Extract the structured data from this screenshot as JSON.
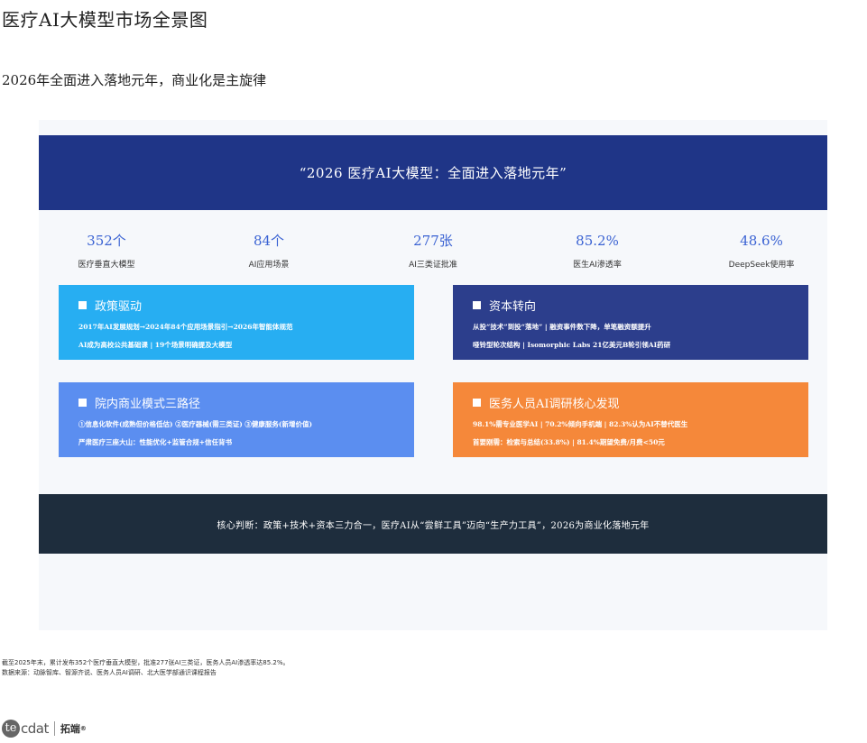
{
  "header": {
    "title": "医疗AI大模型市场全景图",
    "subtitle": "2026年全面进入落地元年，商业化是主旋律"
  },
  "banner": {
    "text": "“2026 医疗AI大模型：全面进入落地元年”"
  },
  "stats": [
    {
      "value": "352个",
      "label": "医疗垂直大模型"
    },
    {
      "value": "84个",
      "label": "AI应用场景"
    },
    {
      "value": "277张",
      "label": "AI三类证批准"
    },
    {
      "value": "85.2%",
      "label": "医生AI渗透率"
    },
    {
      "value": "48.6%",
      "label": "DeepSeek使用率"
    }
  ],
  "cards": {
    "policy": {
      "title": "政策驱动",
      "lines": [
        "2017年AI发展规划→2024年84个应用场景指引→2026年智能体规范",
        "AI成为高校公共基础课 | 19个场景明确提及大模型"
      ]
    },
    "capital": {
      "title": "资本转向",
      "lines": [
        "从投“技术”到投“落地” | 融资事件数下降，单笔融资额提升",
        "哑铃型轮次结构 | Isomorphic Labs 21亿美元B轮引领AI药研"
      ]
    },
    "hospital": {
      "title": "院内商业模式三路径",
      "lines": [
        "①信息化软件(成熟但价格低估) ②医疗器械(需三类证) ③健康服务(新增价值)",
        "严肃医疗三座大山：性能优化+监管合规+信任背书"
      ]
    },
    "survey": {
      "title": "医务人员AI调研核心发现",
      "lines": [
        "98.1%需专业医学AI | 70.2%倾向手机端 | 82.3%认为AI不替代医生",
        "首要刚需：检索与总结(33.8%) | 81.4%期望免费/月费<50元"
      ]
    }
  },
  "conclusion": {
    "text": "核心判断：政策+技术+资本三力合一，医疗AI从“尝鲜工具”迈向“生产力工具”，2026为商业化落地元年"
  },
  "notes": [
    "截至2025年末，累计发布352个医疗垂直大模型，批准277张AI三类证，医务人员AI渗透率达85.2%。",
    "数据来源：动脉智库、智源齐说、医务人员AI调研、北大医学部通识课程报告"
  ],
  "logo": {
    "mark_circle": "te",
    "mark_text": "cdat",
    "cn": "拓端",
    "reg": "®"
  },
  "colors": {
    "banner": "#1f3587",
    "stat_value": "#3b63d3",
    "policy": "#27aef2",
    "capital": "#2c3e8c",
    "hospital": "#5b8ef0",
    "survey": "#f5883a",
    "conclusion": "#1e2d3d"
  }
}
